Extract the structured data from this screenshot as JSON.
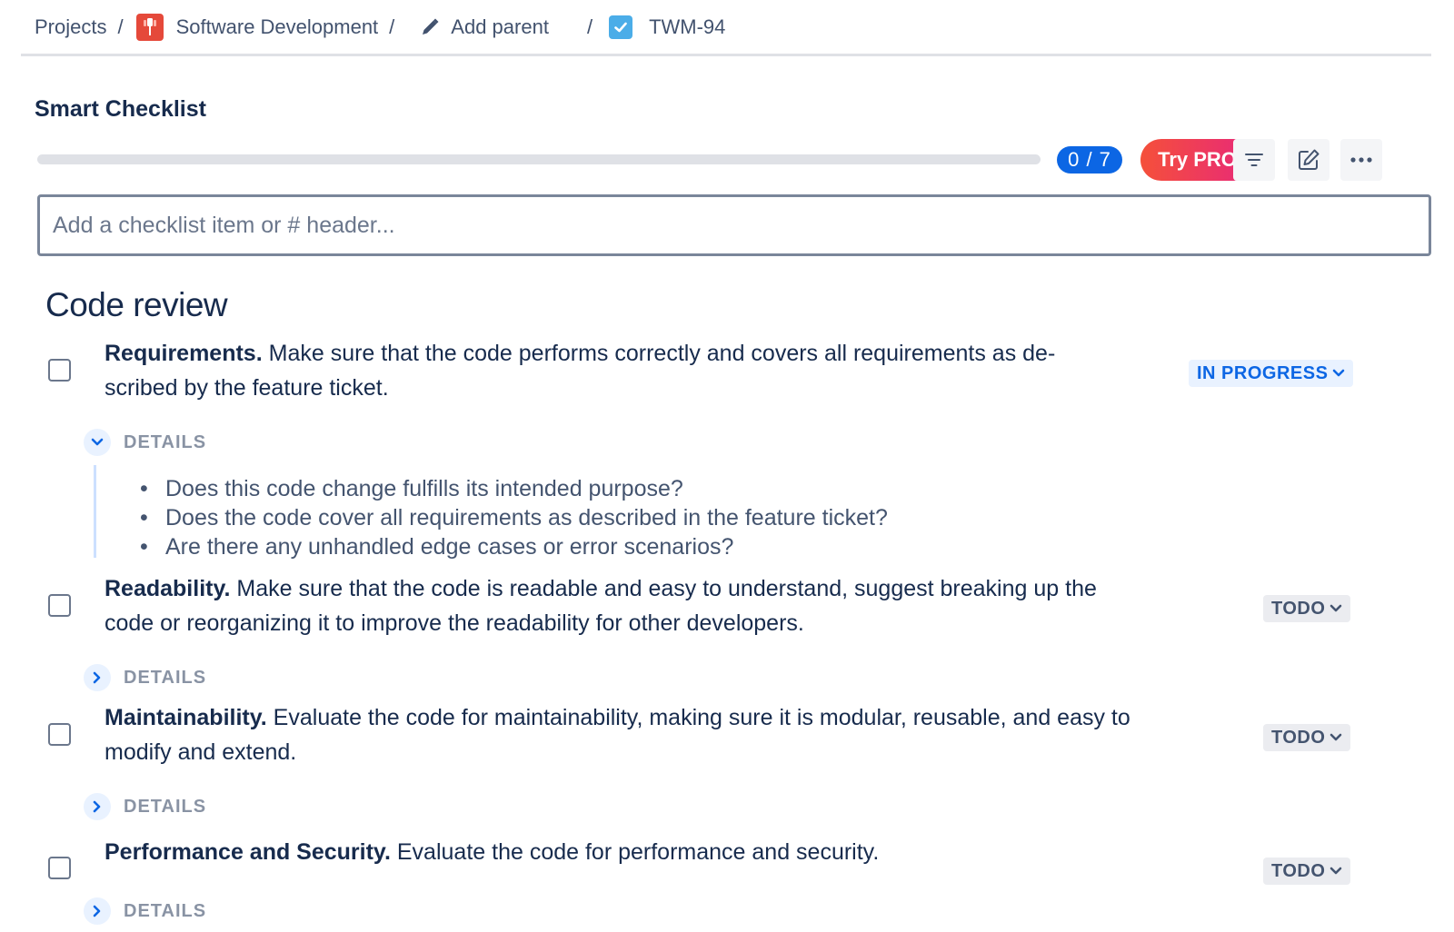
{
  "breadcrumb": {
    "projects": "Projects",
    "project_name": "Software Development",
    "add_parent": "Add parent",
    "issue_key": "TWM-94",
    "separator": "/"
  },
  "panel": {
    "title": "Smart Checklist",
    "progress_label": "0 / 7",
    "progress_done": 0,
    "progress_total": 7,
    "try_pro_label": "Try PRO",
    "add_placeholder": "Add a checklist item or # header..."
  },
  "section": {
    "title": "Code review"
  },
  "items": [
    {
      "title": "Requirements.",
      "text_line1": " Make sure that the code performs correctly and covers all requirements as de-",
      "text_line2": "scribed by the feature ticket.",
      "status": "IN PROGRESS",
      "details_label": "DETAILS",
      "details_expanded": true,
      "details": [
        "Does this code change fulfills its intended purpose?",
        "Does the code cover all requirements as described in the feature ticket?",
        "Are there any unhandled edge cases or error scenarios?"
      ]
    },
    {
      "title": "Readability.",
      "text_line1": " Make sure that the code is readable and easy to understand, suggest breaking up the",
      "text_line2": "code or reorganizing it to improve the readability for other developers.",
      "status": "TODO",
      "details_label": "DETAILS",
      "details_expanded": false
    },
    {
      "title": "Maintainability.",
      "text_line1": " Evaluate the code for maintainability, making sure it is modular, reusable, and easy to",
      "text_line2": "modify and extend.",
      "status": "TODO",
      "details_label": "DETAILS",
      "details_expanded": false
    },
    {
      "title": "Performance and Security.",
      "text_line1": " Evaluate the code for performance and security.",
      "status": "TODO",
      "details_label": "DETAILS",
      "details_expanded": false
    }
  ],
  "colors": {
    "primary_blue": "#0C66E4",
    "try_pro_start": "#F5503A",
    "try_pro_end": "#E8287A",
    "text": "#172B4D"
  }
}
